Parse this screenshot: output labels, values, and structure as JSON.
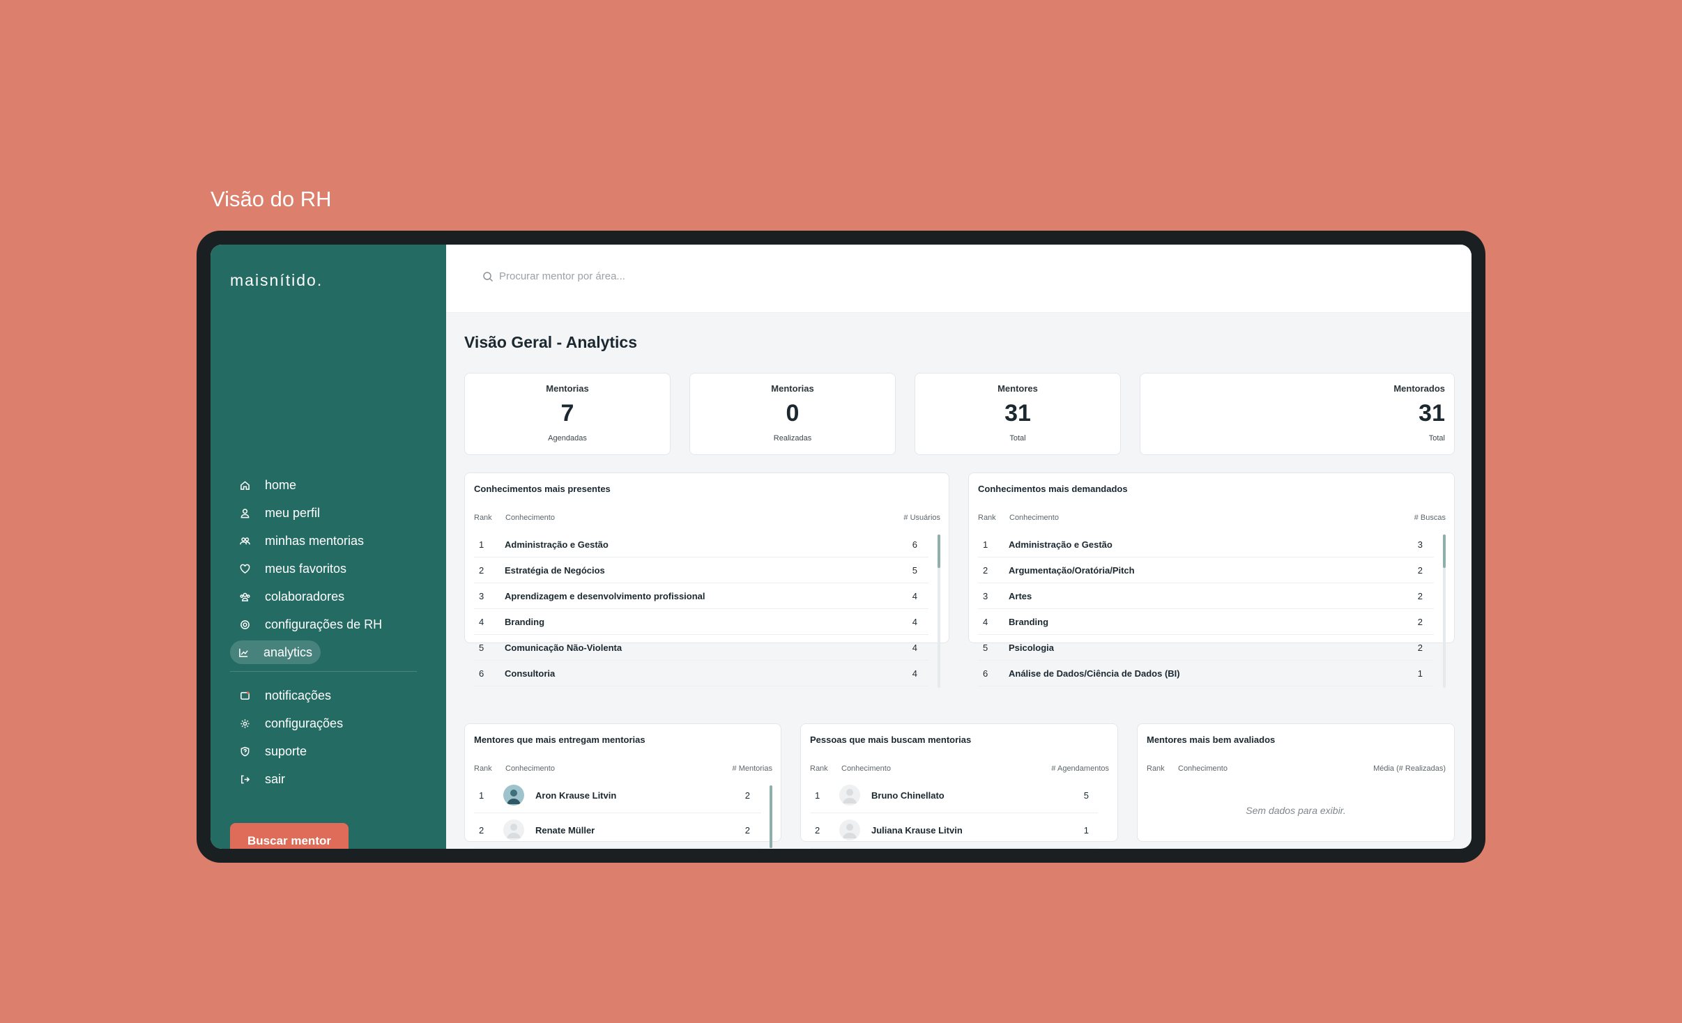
{
  "caption": "Visão do RH",
  "sidebar": {
    "logo": "maisnítido.",
    "items": [
      {
        "label": "home",
        "icon": "home-icon"
      },
      {
        "label": "meu perfil",
        "icon": "user-icon"
      },
      {
        "label": "minhas mentorias",
        "icon": "users-icon"
      },
      {
        "label": "meus favoritos",
        "icon": "heart-icon"
      },
      {
        "label": "colaboradores",
        "icon": "team-icon"
      },
      {
        "label": "configurações de RH",
        "icon": "target-icon"
      },
      {
        "label": "analytics",
        "icon": "chart-icon",
        "active": true
      }
    ],
    "secondary_items": [
      {
        "label": "notificações",
        "icon": "bell-icon"
      },
      {
        "label": "configurações",
        "icon": "gear-icon"
      },
      {
        "label": "suporte",
        "icon": "help-icon"
      },
      {
        "label": "sair",
        "icon": "logout-icon"
      }
    ],
    "cta_label": "Buscar mentor"
  },
  "search": {
    "placeholder": "Procurar mentor por área..."
  },
  "page": {
    "title": "Visão Geral - Analytics"
  },
  "stats": [
    {
      "label": "Mentorias",
      "value": "7",
      "sub": "Agendadas"
    },
    {
      "label": "Mentorias",
      "value": "0",
      "sub": "Realizadas"
    },
    {
      "label": "Mentores",
      "value": "31",
      "sub": "Total"
    },
    {
      "label": "Mentorados",
      "value": "31",
      "sub": "Total"
    }
  ],
  "panels": {
    "presentes": {
      "title": "Conhecimentos mais presentes",
      "columns": [
        "Rank",
        "Conhecimento",
        "# Usuários"
      ],
      "rows": [
        {
          "rank": "1",
          "name": "Administração e Gestão",
          "value": "6"
        },
        {
          "rank": "2",
          "name": "Estratégia de Negócios",
          "value": "5"
        },
        {
          "rank": "3",
          "name": "Aprendizagem e desenvolvimento profissional",
          "value": "4"
        },
        {
          "rank": "4",
          "name": "Branding",
          "value": "4"
        },
        {
          "rank": "5",
          "name": "Comunicação Não-Violenta",
          "value": "4"
        },
        {
          "rank": "6",
          "name": "Consultoria",
          "value": "4"
        }
      ]
    },
    "demandados": {
      "title": "Conhecimentos mais demandados",
      "columns": [
        "Rank",
        "Conhecimento",
        "# Buscas"
      ],
      "rows": [
        {
          "rank": "1",
          "name": "Administração e Gestão",
          "value": "3"
        },
        {
          "rank": "2",
          "name": "Argumentação/Oratória/Pitch",
          "value": "2"
        },
        {
          "rank": "3",
          "name": "Artes",
          "value": "2"
        },
        {
          "rank": "4",
          "name": "Branding",
          "value": "2"
        },
        {
          "rank": "5",
          "name": "Psicologia",
          "value": "2"
        },
        {
          "rank": "6",
          "name": "Análise de Dados/Ciência de Dados (BI)",
          "value": "1"
        }
      ]
    },
    "entregam": {
      "title": "Mentores que mais entregam mentorias",
      "columns": [
        "Rank",
        "Conhecimento",
        "# Mentorias"
      ],
      "rows": [
        {
          "rank": "1",
          "name": "Aron Krause Litvin",
          "value": "2",
          "avatar": "photo"
        },
        {
          "rank": "2",
          "name": "Renate  Müller",
          "value": "2",
          "avatar": "placeholder"
        }
      ]
    },
    "buscam": {
      "title": "Pessoas que mais buscam mentorias",
      "columns": [
        "Rank",
        "Conhecimento",
        "# Agendamentos"
      ],
      "rows": [
        {
          "rank": "1",
          "name": "Bruno Chinellato",
          "value": "5",
          "avatar": "placeholder"
        },
        {
          "rank": "2",
          "name": "Juliana  Krause Litvin",
          "value": "1",
          "avatar": "placeholder"
        }
      ]
    },
    "avaliados": {
      "title": "Mentores mais bem avaliados",
      "columns": [
        "Rank",
        "Conhecimento",
        "Média (# Realizadas)"
      ],
      "empty_text": "Sem dados para exibir."
    }
  },
  "colors": {
    "background": "#dc7f6c",
    "sidebar": "#246b63",
    "cta": "#df6c58",
    "device": "#1a1f21"
  }
}
